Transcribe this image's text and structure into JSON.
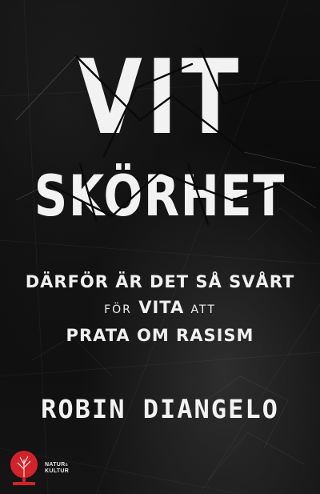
{
  "cover": {
    "title_line1": "VIT",
    "title_line2": "SKÖRHET",
    "subtitle": {
      "line1": "DÄRFÖR ÄR DET SÅ SVÅRT",
      "line2_pre": "FÖR",
      "line2_main": "VITA",
      "line2_post": "ATT",
      "line3": "PRATA OM RASISM"
    },
    "author": "ROBIN DIANGELO",
    "publisher": {
      "name_part1": "NATUR",
      "ampersand": "&",
      "name_part2": "KULTUR",
      "logo_icon": "tree-logo-icon"
    }
  },
  "colors": {
    "background": "#0a0a0a",
    "text": "#f2f2f2",
    "logo_red": "#d2232a"
  }
}
